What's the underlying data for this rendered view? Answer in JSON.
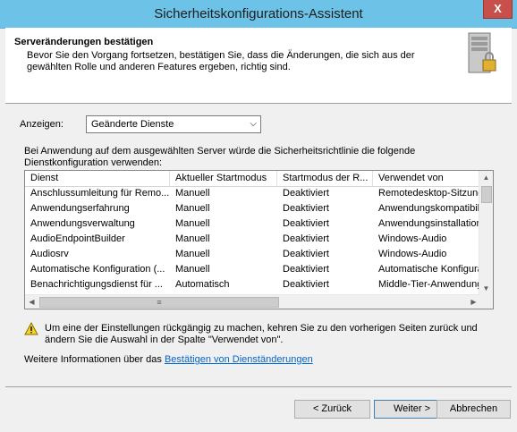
{
  "window": {
    "title": "Sicherheitskonfigurations-Assistent",
    "close_label": "X"
  },
  "header": {
    "title": "Serveränderungen bestätigen",
    "description": "Bevor Sie den Vorgang fortsetzen, bestätigen Sie, dass die Änderungen, die sich aus der gewählten Rolle und anderen Features ergeben, richtig sind."
  },
  "filter": {
    "label": "Anzeigen:",
    "selected": "Geänderte Dienste"
  },
  "intro_text": "Bei Anwendung auf dem ausgewählten Server würde die Sicherheitsrichtlinie die folgende Dienstkonfiguration verwenden:",
  "table": {
    "columns": [
      "Dienst",
      "Aktueller Startmodus",
      "Startmodus der R...",
      "Verwendet von"
    ],
    "rows": [
      [
        "Anschlussumleitung für Remo...",
        "Manuell",
        "Deaktiviert",
        "Remotedesktop-Sitzung"
      ],
      [
        "Anwendungserfahrung",
        "Manuell",
        "Deaktiviert",
        "Anwendungskompatibil"
      ],
      [
        "Anwendungsverwaltung",
        "Manuell",
        "Deaktiviert",
        "Anwendungsinstallation"
      ],
      [
        "AudioEndpointBuilder",
        "Manuell",
        "Deaktiviert",
        "Windows-Audio"
      ],
      [
        "Audiosrv",
        "Manuell",
        "Deaktiviert",
        "Windows-Audio"
      ],
      [
        "Automatische Konfiguration (...",
        "Manuell",
        "Deaktiviert",
        "Automatische Konfigura"
      ],
      [
        "Benachrichtigungsdienst für ...",
        "Automatisch",
        "Deaktiviert",
        "Middle-Tier-Anwendung"
      ]
    ]
  },
  "warning": {
    "text": "Um eine der Einstellungen rückgängig zu machen, kehren Sie zu den vorherigen Seiten zurück und ändern Sie die Auswahl in der Spalte \"Verwendet von\"."
  },
  "more_info": {
    "prefix": "Weitere Informationen über das ",
    "link": "Bestätigen von Dienständerungen"
  },
  "buttons": {
    "back": "< Zurück",
    "next": "Weiter >",
    "cancel": "Abbrechen"
  }
}
